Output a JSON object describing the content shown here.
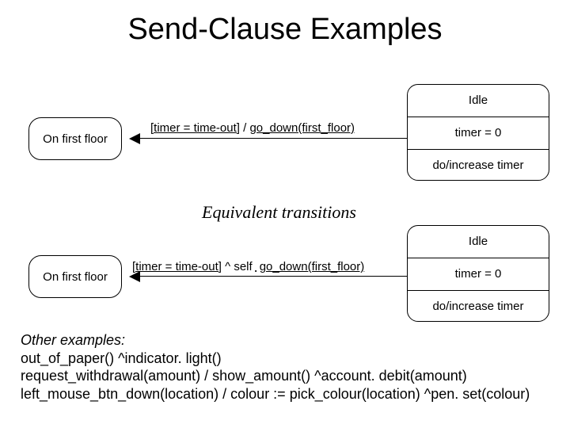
{
  "title": "Send-Clause Examples",
  "equivalent_label": "Equivalent transitions",
  "diagram1": {
    "left_state": "On first floor",
    "right_state": {
      "name": "Idle",
      "entry": "timer = 0",
      "activity": "do/increase timer"
    },
    "transition": {
      "guard": "[timer = time-out]",
      "slash": " / ",
      "action": "go_down(first_floor)"
    }
  },
  "diagram2": {
    "left_state": "On first floor",
    "right_state": {
      "name": "Idle",
      "entry": "timer = 0",
      "activity": "do/increase timer"
    },
    "transition": {
      "guard": "[timer = time-out]",
      "caret_self": "  ^ self",
      "dot": ".",
      "action": "go_down(first_floor)"
    }
  },
  "examples": {
    "header": "Other examples:",
    "lines": [
      "out_of_paper() ^indicator. light()",
      "request_withdrawal(amount) / show_amount() ^account. debit(amount)",
      "left_mouse_btn_down(location) / colour := pick_colour(location) ^pen. set(colour)"
    ]
  }
}
